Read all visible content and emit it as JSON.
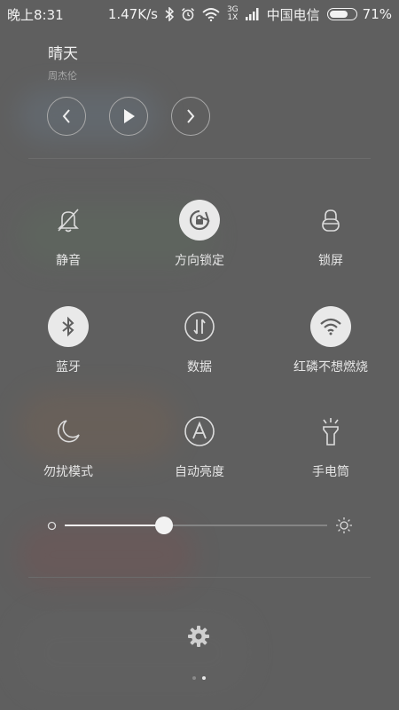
{
  "status_bar": {
    "time": "晚上8:31",
    "speed": "1.47K/s",
    "network_top": "3G",
    "network_bottom": "1X",
    "carrier": "中国电信",
    "battery_percent": "71%",
    "battery_level": 0.71,
    "icons": [
      "bluetooth-icon",
      "alarm-icon",
      "wifi-icon",
      "signal-icon",
      "battery-icon"
    ]
  },
  "music": {
    "title": "晴天",
    "artist": "周杰伦",
    "controls": [
      "previous-icon",
      "play-icon",
      "next-icon"
    ]
  },
  "toggles": [
    {
      "label": "静音",
      "icon": "bell-off-icon",
      "active": false
    },
    {
      "label": "方向锁定",
      "icon": "rotation-lock-icon",
      "active": true
    },
    {
      "label": "锁屏",
      "icon": "lock-icon",
      "active": false
    },
    {
      "label": "蓝牙",
      "icon": "bluetooth-icon",
      "active": true
    },
    {
      "label": "数据",
      "icon": "data-icon",
      "active": false
    },
    {
      "label": "红磷不想燃烧",
      "icon": "wifi-icon",
      "active": true
    },
    {
      "label": "勿扰模式",
      "icon": "moon-icon",
      "active": false
    },
    {
      "label": "自动亮度",
      "icon": "auto-brightness-icon",
      "active": false
    },
    {
      "label": "手电筒",
      "icon": "flashlight-icon",
      "active": false
    }
  ],
  "brightness": {
    "level": 0.38,
    "icons": [
      "brightness-low-icon",
      "brightness-high-icon"
    ]
  },
  "settings_icon": "gear-icon",
  "pages": {
    "count": 2,
    "current": 2
  },
  "colors": {
    "active_tile": "#e9e9e9",
    "panel_bg": "#5f5f5f",
    "text": "#e6e6e6"
  }
}
